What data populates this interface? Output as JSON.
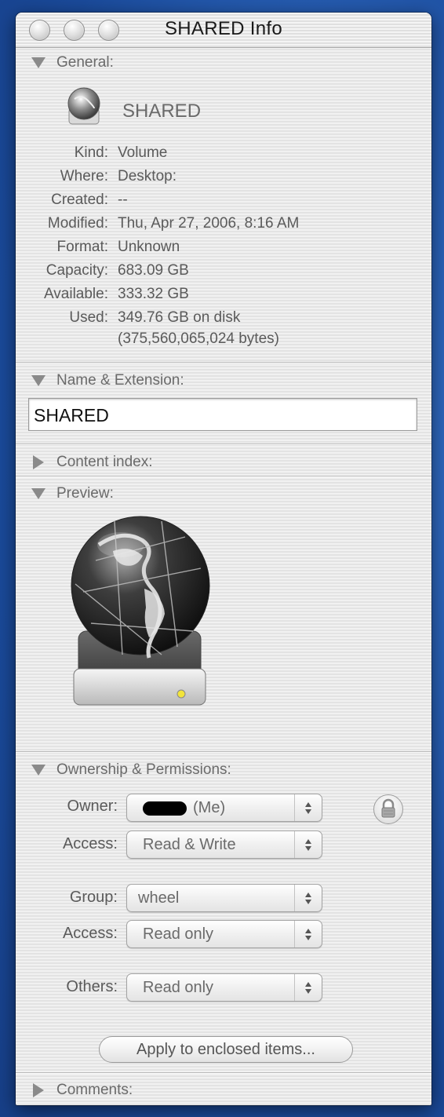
{
  "window": {
    "title": "SHARED Info"
  },
  "general": {
    "header": "General:",
    "volume_name": "SHARED",
    "rows": [
      {
        "key": "Kind:",
        "value": "Volume"
      },
      {
        "key": "Where:",
        "value": "Desktop:"
      },
      {
        "key": "Created:",
        "value": "--"
      },
      {
        "key": "Modified:",
        "value": "Thu, Apr 27, 2006, 8:16 AM"
      },
      {
        "key": "Format:",
        "value": "Unknown"
      },
      {
        "key": "Capacity:",
        "value": "683.09 GB"
      },
      {
        "key": "Available:",
        "value": "333.32 GB"
      },
      {
        "key": "Used:",
        "value": "349.76 GB on disk"
      }
    ],
    "used_bytes": "(375,560,065,024 bytes)"
  },
  "name_extension": {
    "header": "Name & Extension:",
    "value": "SHARED"
  },
  "content_index": {
    "header": "Content index:"
  },
  "preview": {
    "header": "Preview:"
  },
  "ownership": {
    "header": "Ownership & Permissions:",
    "owner_label": "Owner:",
    "owner_value": "(Me)",
    "owner_access_label": "Access:",
    "owner_access": "Read & Write",
    "group_label": "Group:",
    "group_value": "wheel",
    "group_access_label": "Access:",
    "group_access": "Read only",
    "others_label": "Others:",
    "others_access": "Read only",
    "apply_button": "Apply to enclosed items..."
  },
  "comments": {
    "header": "Comments:"
  },
  "icons": {
    "disclosure_open": "triangle-down-icon",
    "disclosure_closed": "triangle-right-icon",
    "lock": "lock-icon",
    "volume": "network-volume-icon"
  }
}
